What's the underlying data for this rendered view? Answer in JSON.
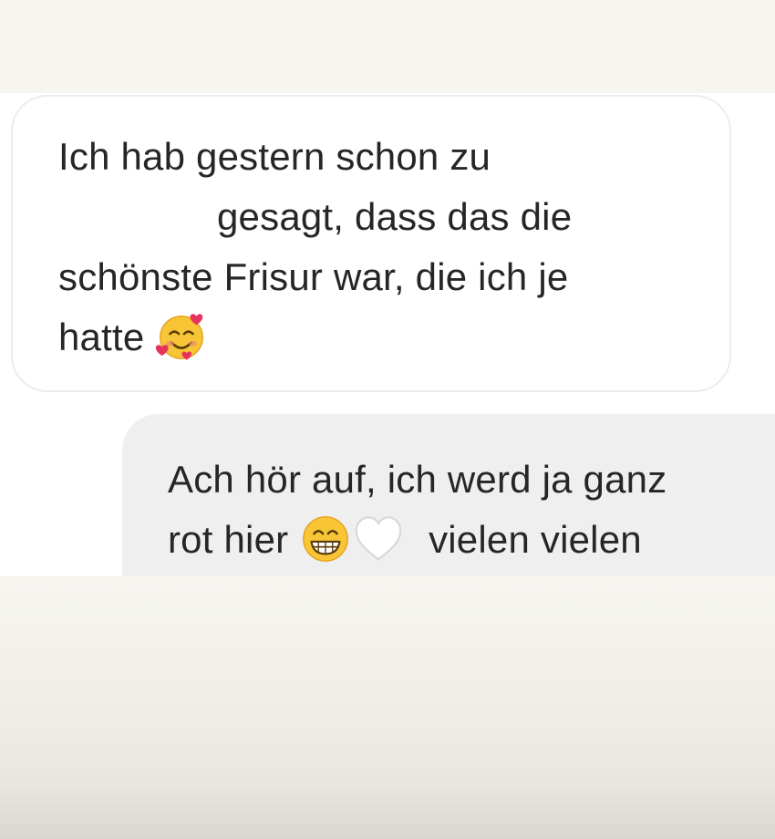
{
  "conversation": {
    "received_message": {
      "lines": [
        "Ich hab gestern schon zu",
        "gesagt, dass das die",
        "schönste Frisur war, die ich je",
        "hatte"
      ],
      "emoji": "smiling-face-with-hearts-icon"
    },
    "sent_message": {
      "line1": "Ach hör auf, ich werd ja ganz",
      "line2_start": "rot hier",
      "line2_end": "vielen vielen",
      "emojis": [
        "grinning-face-icon",
        "white-heart-icon"
      ]
    }
  },
  "colors": {
    "page_background": "#f6f5f0",
    "chat_background": "#ffffff",
    "received_bubble": "#ffffff",
    "received_border": "#ececec",
    "sent_bubble": "#efefef",
    "text": "#262626"
  }
}
